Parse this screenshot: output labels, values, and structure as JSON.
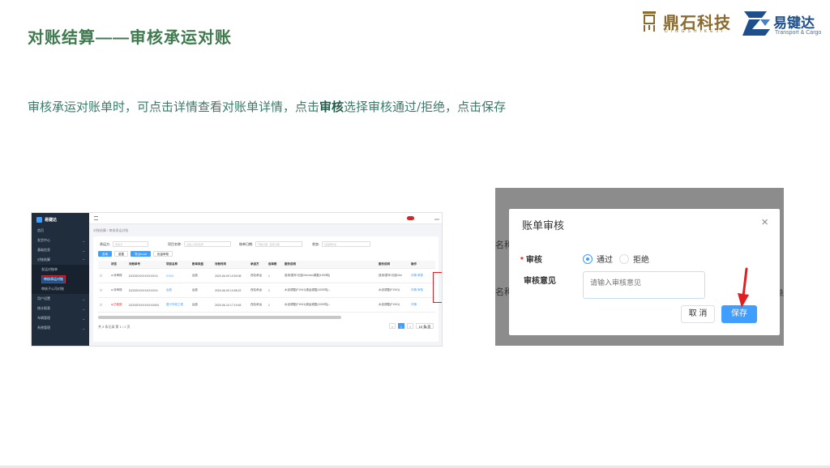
{
  "slide": {
    "title": "对账结算——审核承运对账",
    "description_pre": "审核承运对账单时，可点击详情查看对账单详情，点击",
    "description_bold": "审核",
    "description_post": "选择审核通过/拒绝，点击保存"
  },
  "logos": {
    "dingshi_name": "鼎石科技",
    "dingshi_pinyin": "DINGSHIKEJI",
    "yijianda_name": "易键达",
    "yijianda_sub": "Transport & Cargo"
  },
  "app": {
    "brand": "易键达",
    "user": "xxx",
    "breadcrumb": "对账结算 / 审核承运对账",
    "sidebar": [
      {
        "label": "首页"
      },
      {
        "label": "发货中心"
      },
      {
        "label": "基础信息"
      },
      {
        "label": "对账结算"
      },
      {
        "label": "发运对账单"
      },
      {
        "label": "审核承运对账"
      },
      {
        "label": "审核子公司对账"
      },
      {
        "label": "用户设置"
      },
      {
        "label": "统计报表"
      },
      {
        "label": "车辆管理"
      },
      {
        "label": "系统管理"
      }
    ],
    "filters": [
      {
        "label": "承运方:",
        "placeholder": "承运方"
      },
      {
        "label": "项目名称:",
        "placeholder": "请输入项目名称"
      },
      {
        "label": "账单日期:",
        "placeholder": "开始日期 - 结束日期"
      },
      {
        "label": "状态:",
        "placeholder": "请选择状态"
      }
    ],
    "buttons": {
      "search": "查询",
      "reset": "重置",
      "export": "导出excel",
      "batch": "批量审核"
    },
    "table_headers": [
      "",
      "状态",
      "对账单号",
      "项目名称",
      "账单类型",
      "对账时间",
      "承运方",
      "运单数",
      "服务说明",
      "服务说明",
      "操作"
    ],
    "rows": [
      {
        "status": "● 待审核",
        "no": "DZ2020XXXXXXXXXX",
        "project": "XXXX",
        "type": "运费",
        "time": "2020-06-09 10:53:08",
        "carrier": "西站承运",
        "count": "1",
        "service1": "费用/整车/长距/4m/mm调整(1000吨)",
        "service2": "费用/整车/长距/4m",
        "op1": "详情",
        "op2": "审核"
      },
      {
        "status": "● 待审核",
        "no": "DZ2020XXXXXXXXXX",
        "project": "运费",
        "type": "运费",
        "time": "2020-06-09 10:55:22",
        "carrier": "西站承运",
        "count": "1",
        "service1": "水泥调整(F1941)调运调整(1000吨)...",
        "service2": "水泥调整(F1941)",
        "op1": "详情",
        "op2": "审核"
      },
      {
        "status": "● 已拒绝",
        "no": "DZ2020XXXXXXXX004",
        "project": "嘉兴市政工程",
        "type": "运费",
        "time": "2020-06-10 17:19:45",
        "carrier": "西站承运",
        "count": "1",
        "service1": "水泥调整(F1941)调运调整(1000吨)...",
        "service2": "水泥调整(F1941)",
        "op1": "详情",
        "op2": ""
      }
    ],
    "pagination_info": "共 3 条记录 第 1 / 1 页",
    "current_page": "1",
    "page_size": "10 条/页"
  },
  "dialog": {
    "bg_label_left": "名称",
    "bg_label_left2": "名称",
    "bg_label_right": "单",
    "title": "账单审核",
    "close_symbol": "×",
    "review_label": "审核",
    "option_pass": "通过",
    "option_reject": "拒绝",
    "selected": "通过",
    "opinion_label": "审核意见",
    "opinion_placeholder": "请输入审核意见",
    "cancel": "取 消",
    "save": "保存"
  },
  "colors": {
    "title": "#3f7a4f",
    "primary": "#409eff",
    "danger": "#e02020",
    "sidebar": "#1f2d3d"
  }
}
